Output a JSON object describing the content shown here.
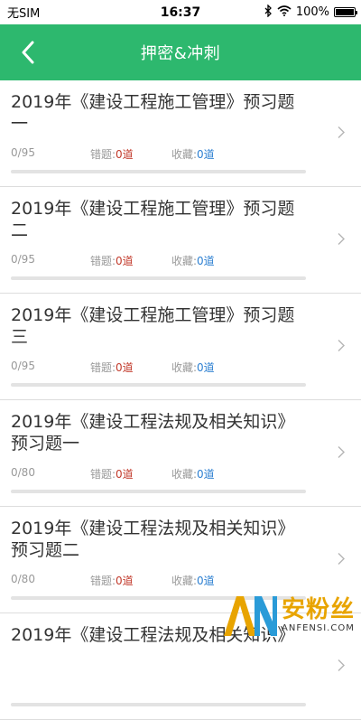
{
  "status_bar": {
    "carrier": "无SIM",
    "time": "16:37",
    "battery": "100%"
  },
  "header": {
    "title": "押密&冲刺",
    "back_icon": "chevron-left-icon"
  },
  "labels": {
    "wrong_label": "错题:",
    "fav_label": "收藏:"
  },
  "exercises": [
    {
      "title": "2019年《建设工程施工管理》预习题一",
      "progress": "0/95",
      "done_fraction": 0,
      "wrong": "0道",
      "fav": "0道"
    },
    {
      "title": "2019年《建设工程施工管理》预习题二",
      "progress": "0/95",
      "done_fraction": 0,
      "wrong": "0道",
      "fav": "0道"
    },
    {
      "title": "2019年《建设工程施工管理》预习题三",
      "progress": "0/95",
      "done_fraction": 0,
      "wrong": "0道",
      "fav": "0道"
    },
    {
      "title": "2019年《建设工程法规及相关知识》预习题一",
      "progress": "0/80",
      "done_fraction": 0,
      "wrong": "0道",
      "fav": "0道"
    },
    {
      "title": "2019年《建设工程法规及相关知识》预习题二",
      "progress": "0/80",
      "done_fraction": 0,
      "wrong": "0道",
      "fav": "0道"
    },
    {
      "title": "2019年《建设工程法规及相关知识》",
      "progress": "",
      "done_fraction": 0,
      "wrong": "",
      "fav": ""
    }
  ],
  "watermark": {
    "logo_text": "AN",
    "cn": "安粉丝",
    "en": "ANFENSI.COM"
  },
  "colors": {
    "accent": "#2db86e",
    "wrong_count": "#c23a2b",
    "fav_count": "#2c7fd1"
  }
}
